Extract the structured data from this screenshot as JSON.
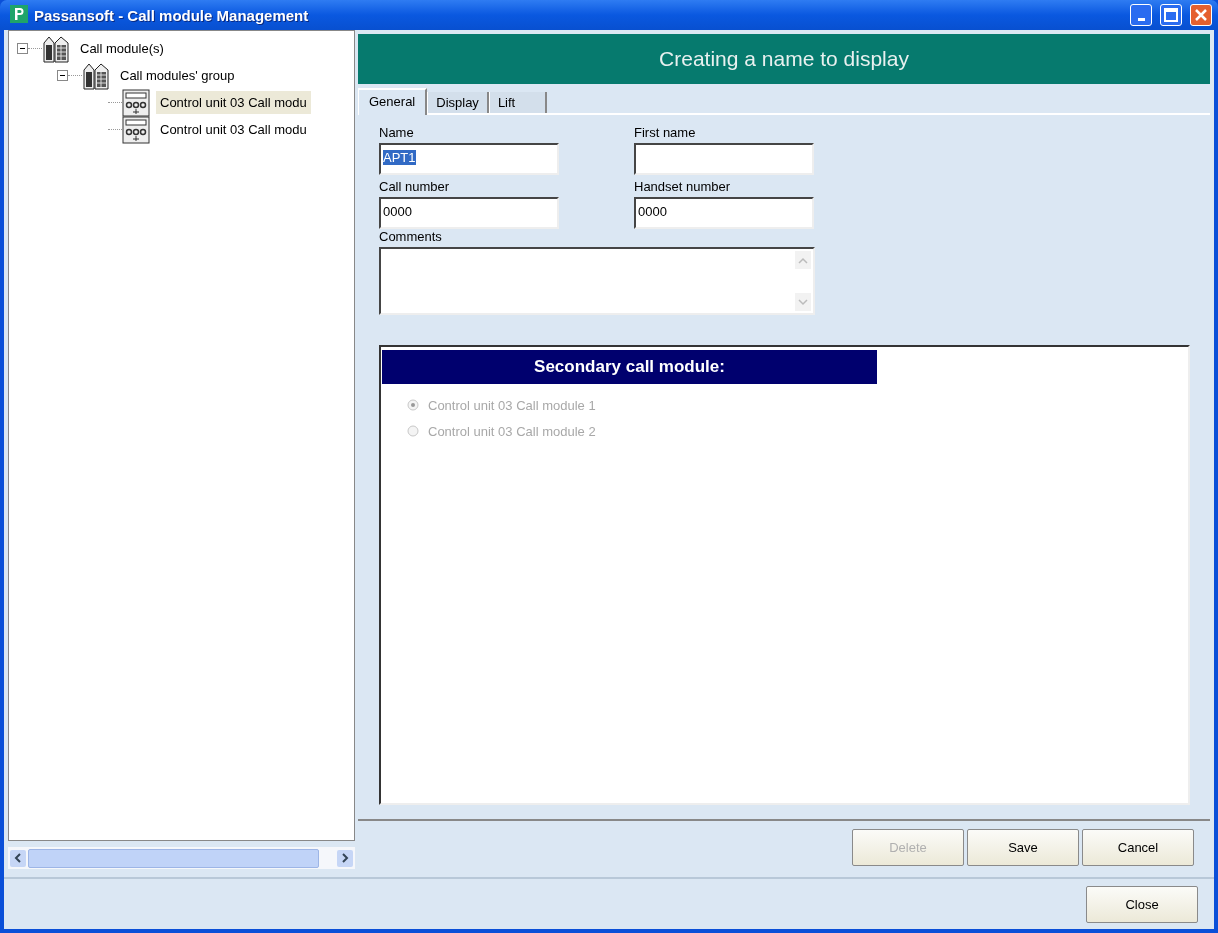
{
  "window": {
    "title": "Passansoft - Call module Management"
  },
  "tree": [
    {
      "label": "Call module(s)",
      "kind": "building",
      "expanded": true,
      "selected": false,
      "children": [
        {
          "label": "Call modules' group",
          "kind": "building",
          "expanded": true,
          "selected": false,
          "children": [
            {
              "label": "Control unit 03 Call modu",
              "kind": "unit",
              "selected": true
            },
            {
              "label": "Control unit 03 Call modu",
              "kind": "unit",
              "selected": false
            }
          ]
        }
      ]
    }
  ],
  "header": {
    "title": "Creating a name to display"
  },
  "tabs": [
    {
      "label": "General",
      "selected": true
    },
    {
      "label": "Display",
      "selected": false
    },
    {
      "label": "Lift",
      "selected": false
    }
  ],
  "fields": [
    {
      "label": "Name",
      "value": "APT1",
      "value_selected": true
    },
    {
      "label": "First name"
    },
    {
      "label": "Call number",
      "value": "0000"
    },
    {
      "label": "Handset number",
      "value": "0000"
    }
  ],
  "comments": {
    "label": "Comments"
  },
  "secondary": {
    "title": "Secondary call module:",
    "options": [
      {
        "label": "Control unit 03 Call module 1",
        "selected": true,
        "disabled": true
      },
      {
        "label": "Control unit 03 Call module 2",
        "selected": false,
        "disabled": true
      }
    ]
  },
  "buttons": [
    {
      "label": "Delete",
      "disabled": true
    },
    {
      "label": "Save",
      "disabled": false
    },
    {
      "label": "Cancel",
      "disabled": false
    }
  ],
  "close_button": {
    "label": "Close"
  }
}
